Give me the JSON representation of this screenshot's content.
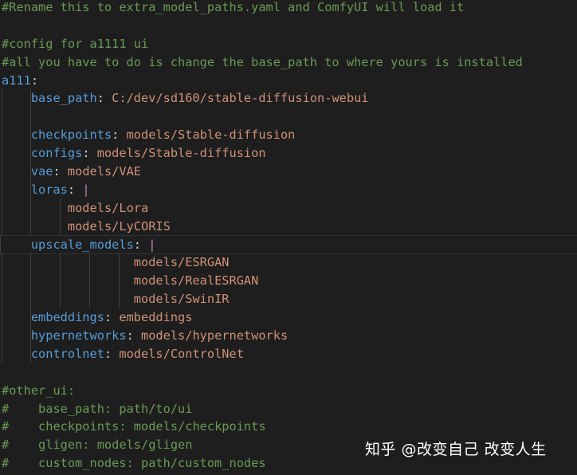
{
  "lines": [
    [
      [
        "c",
        "#Rename this to extra_model_paths.yaml and ComfyUI will load it"
      ]
    ],
    [],
    [
      [
        "c",
        "#config for a1111 ui"
      ]
    ],
    [
      [
        "c",
        "#all you have to do is change the base_path to where yours is installed"
      ]
    ],
    [
      [
        "k",
        "a111"
      ],
      [
        "p",
        ":"
      ]
    ],
    [
      [
        "p",
        "    "
      ],
      [
        "k",
        "base_path"
      ],
      [
        "p",
        ": "
      ],
      [
        "v",
        "C:/dev/sd160/stable-diffusion-webui"
      ]
    ],
    [],
    [
      [
        "p",
        "    "
      ],
      [
        "k",
        "checkpoints"
      ],
      [
        "p",
        ": "
      ],
      [
        "v",
        "models/Stable-diffusion"
      ]
    ],
    [
      [
        "p",
        "    "
      ],
      [
        "k",
        "configs"
      ],
      [
        "p",
        ": "
      ],
      [
        "v",
        "models/Stable-diffusion"
      ]
    ],
    [
      [
        "p",
        "    "
      ],
      [
        "k",
        "vae"
      ],
      [
        "p",
        ": "
      ],
      [
        "v",
        "models/VAE"
      ]
    ],
    [
      [
        "p",
        "    "
      ],
      [
        "k",
        "loras"
      ],
      [
        "p",
        ": "
      ],
      [
        "b",
        "|"
      ]
    ],
    [
      [
        "p",
        "         "
      ],
      [
        "v",
        "models/Lora"
      ]
    ],
    [
      [
        "p",
        "         "
      ],
      [
        "v",
        "models/LyCORIS"
      ]
    ],
    [
      [
        "p",
        "    "
      ],
      [
        "k",
        "upscale_models"
      ],
      [
        "p",
        ": "
      ],
      [
        "b",
        "|"
      ]
    ],
    [
      [
        "p",
        "                  "
      ],
      [
        "v",
        "models/ESRGAN"
      ]
    ],
    [
      [
        "p",
        "                  "
      ],
      [
        "v",
        "models/RealESRGAN"
      ]
    ],
    [
      [
        "p",
        "                  "
      ],
      [
        "v",
        "models/SwinIR"
      ]
    ],
    [
      [
        "p",
        "    "
      ],
      [
        "k",
        "embeddings"
      ],
      [
        "p",
        ": "
      ],
      [
        "v",
        "embeddings"
      ]
    ],
    [
      [
        "p",
        "    "
      ],
      [
        "k",
        "hypernetworks"
      ],
      [
        "p",
        ": "
      ],
      [
        "v",
        "models/hypernetworks"
      ]
    ],
    [
      [
        "p",
        "    "
      ],
      [
        "k",
        "controlnet"
      ],
      [
        "p",
        ": "
      ],
      [
        "v",
        "models/ControlNet"
      ]
    ],
    [],
    [
      [
        "c",
        "#other_ui:"
      ]
    ],
    [
      [
        "c",
        "#    base_path: path/to/ui"
      ]
    ],
    [
      [
        "c",
        "#    checkpoints: models/checkpoints"
      ]
    ],
    [
      [
        "c",
        "#    gligen: models/gligen"
      ]
    ],
    [
      [
        "c",
        "#    custom_nodes: path/custom_nodes"
      ]
    ]
  ],
  "current_line": 13,
  "watermark": "知乎 @改变自己 改变人生",
  "colors": {
    "background": "#1e1e1e",
    "comment": "#6a9955",
    "key": "#569cd6",
    "value": "#ce9178",
    "punctuation": "#d4d4d4",
    "block_indicator": "#c586c0"
  }
}
